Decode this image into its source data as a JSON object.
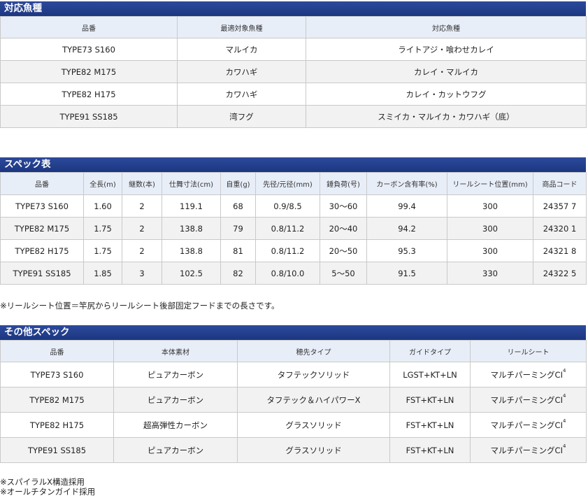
{
  "fish": {
    "title": "対応魚種",
    "headers": [
      "品番",
      "最適対象魚種",
      "対応魚種"
    ],
    "rows": [
      [
        "TYPE73 S160",
        "マルイカ",
        "ライトアジ・喰わせカレイ"
      ],
      [
        "TYPE82 M175",
        "カワハギ",
        "カレイ・マルイカ"
      ],
      [
        "TYPE82 H175",
        "カワハギ",
        "カレイ・カットウフグ"
      ],
      [
        "TYPE91 SS185",
        "湾フグ",
        "スミイカ・マルイカ・カワハギ（底）"
      ]
    ]
  },
  "spec": {
    "title": "スペック表",
    "headers": [
      "品番",
      "全長(m)",
      "継数(本)",
      "仕舞寸法(cm)",
      "自重(g)",
      "先径/元径(mm)",
      "錘負荷(号)",
      "カーボン含有率(%)",
      "リールシート位置(mm)",
      "商品コード"
    ],
    "rows": [
      [
        "TYPE73 S160",
        "1.60",
        "2",
        "119.1",
        "68",
        "0.9/8.5",
        "30〜60",
        "99.4",
        "300",
        "24357 7"
      ],
      [
        "TYPE82 M175",
        "1.75",
        "2",
        "138.8",
        "79",
        "0.8/11.2",
        "20〜40",
        "94.2",
        "300",
        "24320 1"
      ],
      [
        "TYPE82 H175",
        "1.75",
        "2",
        "138.8",
        "81",
        "0.8/11.2",
        "20〜50",
        "95.3",
        "300",
        "24321 8"
      ],
      [
        "TYPE91 SS185",
        "1.85",
        "3",
        "102.5",
        "82",
        "0.8/10.0",
        "5〜50",
        "91.5",
        "330",
        "24322 5"
      ]
    ],
    "note": "※リールシート位置＝竿尻からリールシート後部固定フードまでの長さです。"
  },
  "other": {
    "title": "その他スペック",
    "headers": [
      "品番",
      "本体素材",
      "穂先タイプ",
      "ガイドタイプ",
      "リールシート"
    ],
    "rows": [
      [
        "TYPE73 S160",
        "ピュアカーボン",
        "タフテックソリッド",
        "LGST+KT+LN",
        "マルチパーミングCI"
      ],
      [
        "TYPE82 M175",
        "ピュアカーボン",
        "タフテック＆ハイパワーX",
        "FST+KT+LN",
        "マルチパーミングCI"
      ],
      [
        "TYPE82 H175",
        "超高弾性カーボン",
        "グラスソリッド",
        "FST+KT+LN",
        "マルチパーミングCI"
      ],
      [
        "TYPE91 SS185",
        "ピュアカーボン",
        "グラスソリッド",
        "FST+KT+LN",
        "マルチパーミングCI"
      ]
    ],
    "sup": "4",
    "notes": [
      "※スパイラルX構造採用",
      "※オールチタンガイド採用"
    ]
  }
}
